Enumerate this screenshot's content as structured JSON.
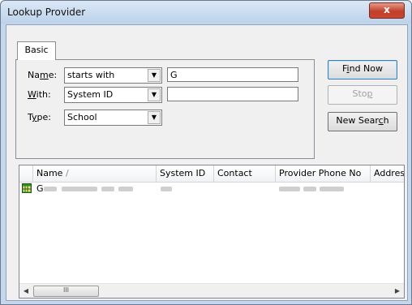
{
  "window": {
    "title": "Lookup Provider",
    "close_glyph": "x"
  },
  "tabs": [
    {
      "label": "Basic"
    }
  ],
  "form": {
    "name_label_pre": "Na",
    "name_label_u": "m",
    "name_label_post": "e:",
    "name_operator": "starts with",
    "name_value": "G",
    "with_label_pre": "",
    "with_label_u": "W",
    "with_label_post": "ith:",
    "with_field": "System ID",
    "with_value": "",
    "type_label_pre": "T",
    "type_label_u": "y",
    "type_label_post": "pe:",
    "type_value": "School"
  },
  "buttons": {
    "find_pre": "F",
    "find_u": "i",
    "find_post": "nd Now",
    "stop_pre": "Sto",
    "stop_u": "p",
    "stop_post": "",
    "new_pre": "New Sear",
    "new_u": "c",
    "new_post": "h"
  },
  "list": {
    "columns": [
      "Name",
      "System ID",
      "Contact",
      "Provider Phone No",
      "Address"
    ],
    "sort_indicator": "/",
    "rows": [
      {
        "name_prefix": "G"
      }
    ]
  },
  "scrollbar": {
    "left_arrow": "◀",
    "right_arrow": "▶",
    "grip": "III"
  },
  "icons": {
    "calendar": "calendar-icon",
    "dropdown": "chevron-down-icon"
  }
}
